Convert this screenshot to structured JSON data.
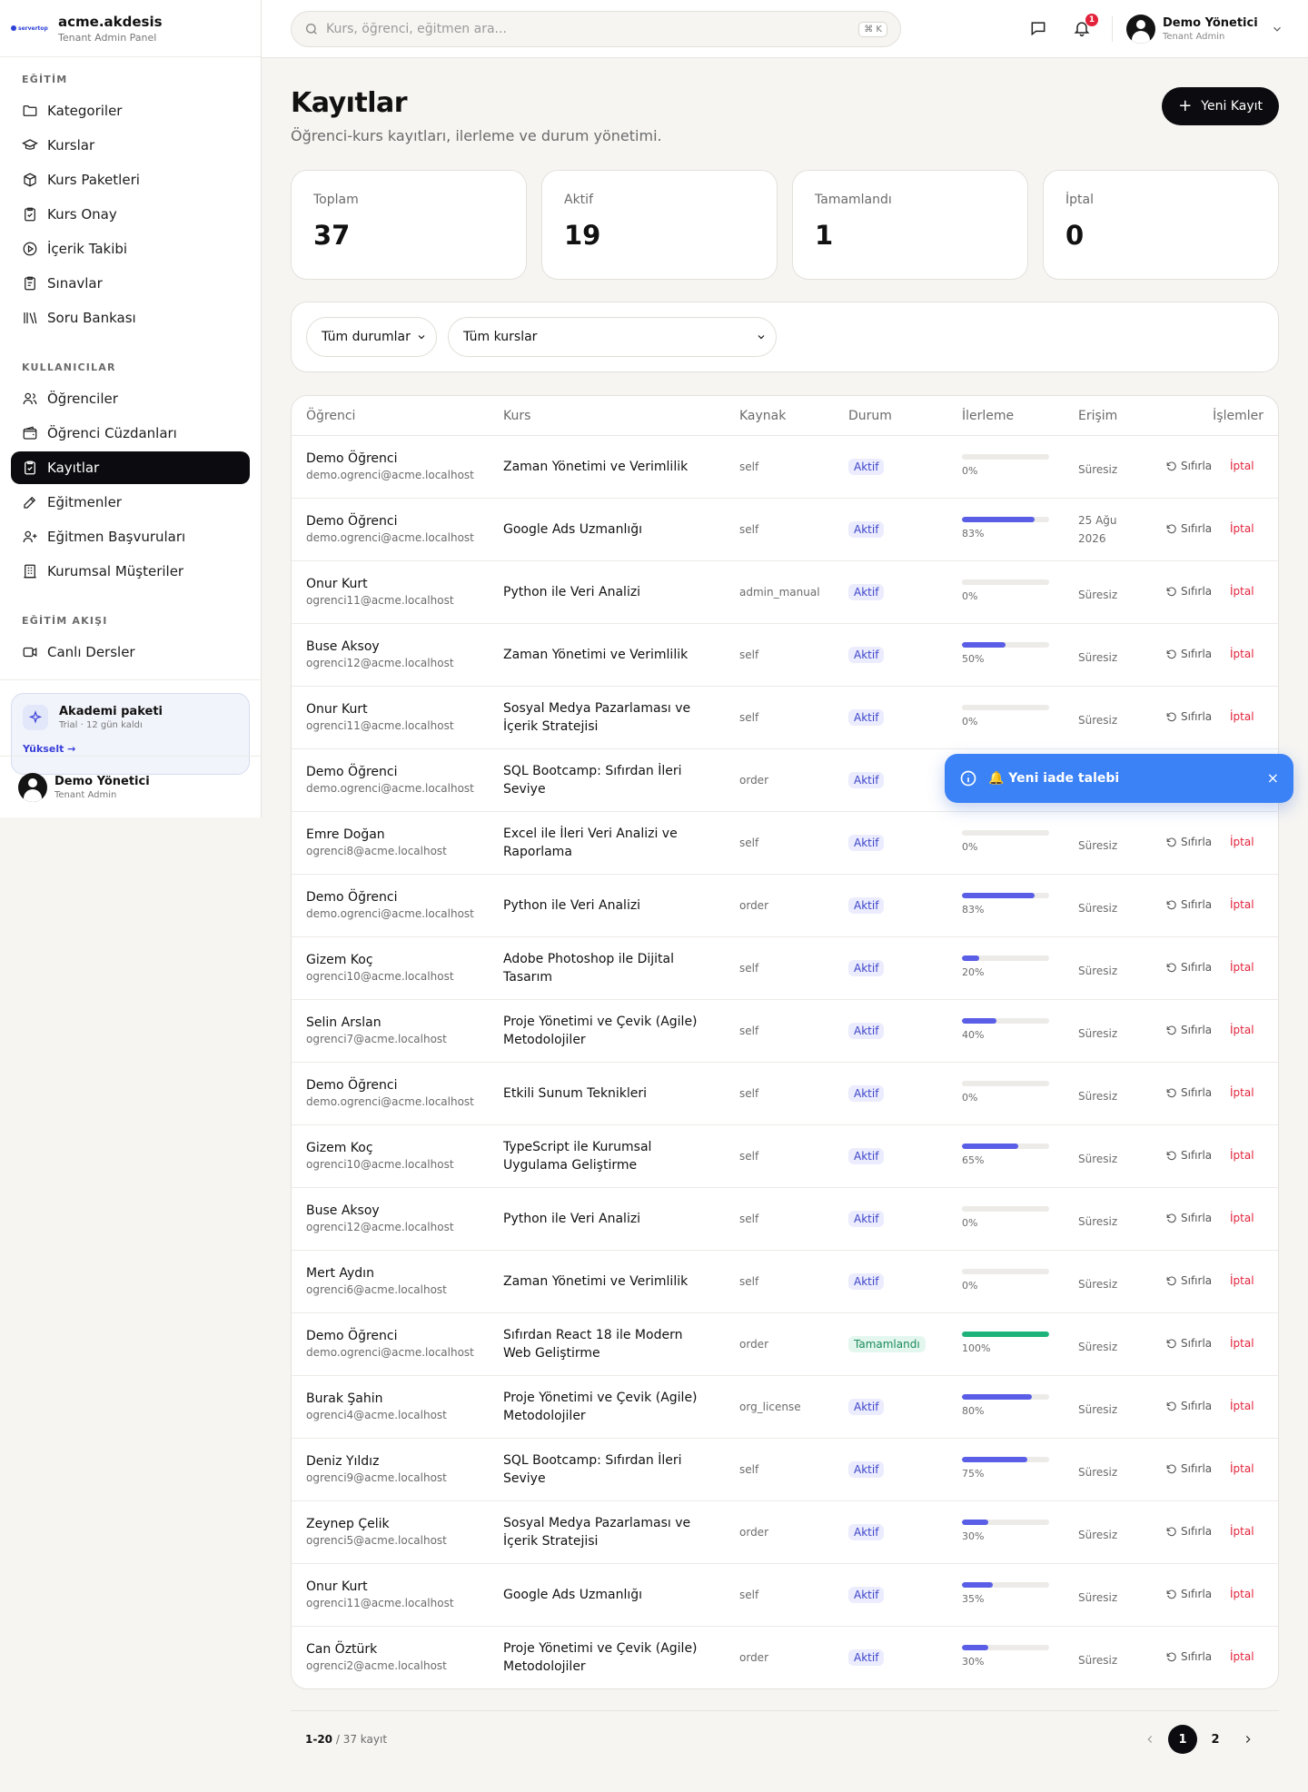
{
  "brand": {
    "logo_text": "servertop",
    "name": "acme.akdesis",
    "subtitle": "Tenant Admin Panel"
  },
  "sidebar": {
    "sections": [
      {
        "title": "EĞİTİM",
        "items": [
          {
            "label": "Kategoriler",
            "icon": "folder-icon"
          },
          {
            "label": "Kurslar",
            "icon": "graduation-cap-icon"
          },
          {
            "label": "Kurs Paketleri",
            "icon": "package-icon"
          },
          {
            "label": "Kurs Onay",
            "icon": "clipboard-check-icon"
          },
          {
            "label": "İçerik Takibi",
            "icon": "play-circle-icon"
          },
          {
            "label": "Sınavlar",
            "icon": "clipboard-list-icon"
          },
          {
            "label": "Soru Bankası",
            "icon": "library-icon"
          }
        ]
      },
      {
        "title": "KULLANICILAR",
        "items": [
          {
            "label": "Öğrenciler",
            "icon": "users-icon"
          },
          {
            "label": "Öğrenci Cüzdanları",
            "icon": "wallet-icon"
          },
          {
            "label": "Kayıtlar",
            "icon": "clipboard-icon",
            "active": true
          },
          {
            "label": "Eğitmenler",
            "icon": "pen-icon"
          },
          {
            "label": "Eğitmen Başvuruları",
            "icon": "user-plus-icon"
          },
          {
            "label": "Kurumsal Müşteriler",
            "icon": "building-icon"
          }
        ]
      },
      {
        "title": "EĞİTİM AKIŞI",
        "items": [
          {
            "label": "Canlı Dersler",
            "icon": "video-icon"
          }
        ]
      }
    ],
    "promo": {
      "title": "Akademi paketi",
      "subtitle": "Trial · 12 gün kaldı",
      "link": "Yükselt →"
    },
    "user": {
      "name": "Demo Yönetici",
      "role": "Tenant Admin"
    }
  },
  "topbar": {
    "search_placeholder": "Kurs, öğrenci, eğitmen ara...",
    "search_shortcut": "⌘ K",
    "notification_count": "1",
    "user": {
      "name": "Demo Yönetici",
      "role": "Tenant Admin"
    }
  },
  "page": {
    "title": "Kayıtlar",
    "subtitle": "Öğrenci-kurs kayıtları, ilerleme ve durum yönetimi.",
    "new_button": "Yeni Kayıt"
  },
  "stats": [
    {
      "label": "Toplam",
      "value": "37"
    },
    {
      "label": "Aktif",
      "value": "19"
    },
    {
      "label": "Tamamlandı",
      "value": "1"
    },
    {
      "label": "İptal",
      "value": "0"
    }
  ],
  "filters": {
    "status": "Tüm durumlar",
    "course": "Tüm kurslar"
  },
  "table": {
    "headers": {
      "student": "Öğrenci",
      "course": "Kurs",
      "source": "Kaynak",
      "status": "Durum",
      "progress": "İlerleme",
      "access": "Erişim",
      "actions": "İşlemler"
    },
    "reset_label": "Sıfırla",
    "cancel_label": "İptal",
    "rows": [
      {
        "name": "Demo Öğrenci",
        "email": "demo.ogrenci@acme.localhost",
        "course": "Zaman Yönetimi ve Verimlilik",
        "source": "self",
        "status": "Aktif",
        "progress": 0,
        "progress_label": "0%",
        "access": "Süresiz"
      },
      {
        "name": "Demo Öğrenci",
        "email": "demo.ogrenci@acme.localhost",
        "course": "Google Ads Uzmanlığı",
        "source": "self",
        "status": "Aktif",
        "progress": 83,
        "progress_label": "83%",
        "access": "25 Ağu 2026"
      },
      {
        "name": "Onur Kurt",
        "email": "ogrenci11@acme.localhost",
        "course": "Python ile Veri Analizi",
        "source": "admin_manual",
        "status": "Aktif",
        "progress": 0,
        "progress_label": "0%",
        "access": "Süresiz"
      },
      {
        "name": "Buse Aksoy",
        "email": "ogrenci12@acme.localhost",
        "course": "Zaman Yönetimi ve Verimlilik",
        "source": "self",
        "status": "Aktif",
        "progress": 50,
        "progress_label": "50%",
        "access": "Süresiz"
      },
      {
        "name": "Onur Kurt",
        "email": "ogrenci11@acme.localhost",
        "course": "Sosyal Medya Pazarlaması ve İçerik Stratejisi",
        "source": "self",
        "status": "Aktif",
        "progress": 0,
        "progress_label": "0%",
        "access": "Süresiz"
      },
      {
        "name": "Demo Öğrenci",
        "email": "demo.ogrenci@acme.localhost",
        "course": "SQL Bootcamp: Sıfırdan İleri Seviye",
        "source": "order",
        "status": "Aktif",
        "progress": 0,
        "progress_label": "",
        "access": ""
      },
      {
        "name": "Emre Doğan",
        "email": "ogrenci8@acme.localhost",
        "course": "Excel ile İleri Veri Analizi ve Raporlama",
        "source": "self",
        "status": "Aktif",
        "progress": 0,
        "progress_label": "0%",
        "access": "Süresiz"
      },
      {
        "name": "Demo Öğrenci",
        "email": "demo.ogrenci@acme.localhost",
        "course": "Python ile Veri Analizi",
        "source": "order",
        "status": "Aktif",
        "progress": 83,
        "progress_label": "83%",
        "access": "Süresiz"
      },
      {
        "name": "Gizem Koç",
        "email": "ogrenci10@acme.localhost",
        "course": "Adobe Photoshop ile Dijital Tasarım",
        "source": "self",
        "status": "Aktif",
        "progress": 20,
        "progress_label": "20%",
        "access": "Süresiz"
      },
      {
        "name": "Selin Arslan",
        "email": "ogrenci7@acme.localhost",
        "course": "Proje Yönetimi ve Çevik (Agile) Metodolojiler",
        "source": "self",
        "status": "Aktif",
        "progress": 40,
        "progress_label": "40%",
        "access": "Süresiz"
      },
      {
        "name": "Demo Öğrenci",
        "email": "demo.ogrenci@acme.localhost",
        "course": "Etkili Sunum Teknikleri",
        "source": "self",
        "status": "Aktif",
        "progress": 0,
        "progress_label": "0%",
        "access": "Süresiz"
      },
      {
        "name": "Gizem Koç",
        "email": "ogrenci10@acme.localhost",
        "course": "TypeScript ile Kurumsal Uygulama Geliştirme",
        "source": "self",
        "status": "Aktif",
        "progress": 65,
        "progress_label": "65%",
        "access": "Süresiz"
      },
      {
        "name": "Buse Aksoy",
        "email": "ogrenci12@acme.localhost",
        "course": "Python ile Veri Analizi",
        "source": "self",
        "status": "Aktif",
        "progress": 0,
        "progress_label": "0%",
        "access": "Süresiz"
      },
      {
        "name": "Mert Aydın",
        "email": "ogrenci6@acme.localhost",
        "course": "Zaman Yönetimi ve Verimlilik",
        "source": "self",
        "status": "Aktif",
        "progress": 0,
        "progress_label": "0%",
        "access": "Süresiz"
      },
      {
        "name": "Demo Öğrenci",
        "email": "demo.ogrenci@acme.localhost",
        "course": "Sıfırdan React 18 ile Modern Web Geliştirme",
        "source": "order",
        "status": "Tamamlandı",
        "progress": 100,
        "progress_label": "100%",
        "access": "Süresiz"
      },
      {
        "name": "Burak Şahin",
        "email": "ogrenci4@acme.localhost",
        "course": "Proje Yönetimi ve Çevik (Agile) Metodolojiler",
        "source": "org_license",
        "status": "Aktif",
        "progress": 80,
        "progress_label": "80%",
        "access": "Süresiz"
      },
      {
        "name": "Deniz Yıldız",
        "email": "ogrenci9@acme.localhost",
        "course": "SQL Bootcamp: Sıfırdan İleri Seviye",
        "source": "self",
        "status": "Aktif",
        "progress": 75,
        "progress_label": "75%",
        "access": "Süresiz"
      },
      {
        "name": "Zeynep Çelik",
        "email": "ogrenci5@acme.localhost",
        "course": "Sosyal Medya Pazarlaması ve İçerik Stratejisi",
        "source": "order",
        "status": "Aktif",
        "progress": 30,
        "progress_label": "30%",
        "access": "Süresiz"
      },
      {
        "name": "Onur Kurt",
        "email": "ogrenci11@acme.localhost",
        "course": "Google Ads Uzmanlığı",
        "source": "self",
        "status": "Aktif",
        "progress": 35,
        "progress_label": "35%",
        "access": "Süresiz"
      },
      {
        "name": "Can Öztürk",
        "email": "ogrenci2@acme.localhost",
        "course": "Proje Yönetimi ve Çevik (Agile) Metodolojiler",
        "source": "order",
        "status": "Aktif",
        "progress": 30,
        "progress_label": "30%",
        "access": "Süresiz"
      }
    ]
  },
  "pagination": {
    "range": "1-20",
    "total": "/ 37 kayıt",
    "pages": [
      "1",
      "2"
    ],
    "current": "1"
  },
  "toast": {
    "message": "🔔 Yeni iade talebi",
    "icon": "info-icon",
    "close": "×"
  },
  "colors": {
    "accent": "#5a5ee6",
    "dark": "#0c0c10",
    "danger": "#e2223a",
    "success": "#1db37a",
    "toast": "#3b82f6"
  }
}
